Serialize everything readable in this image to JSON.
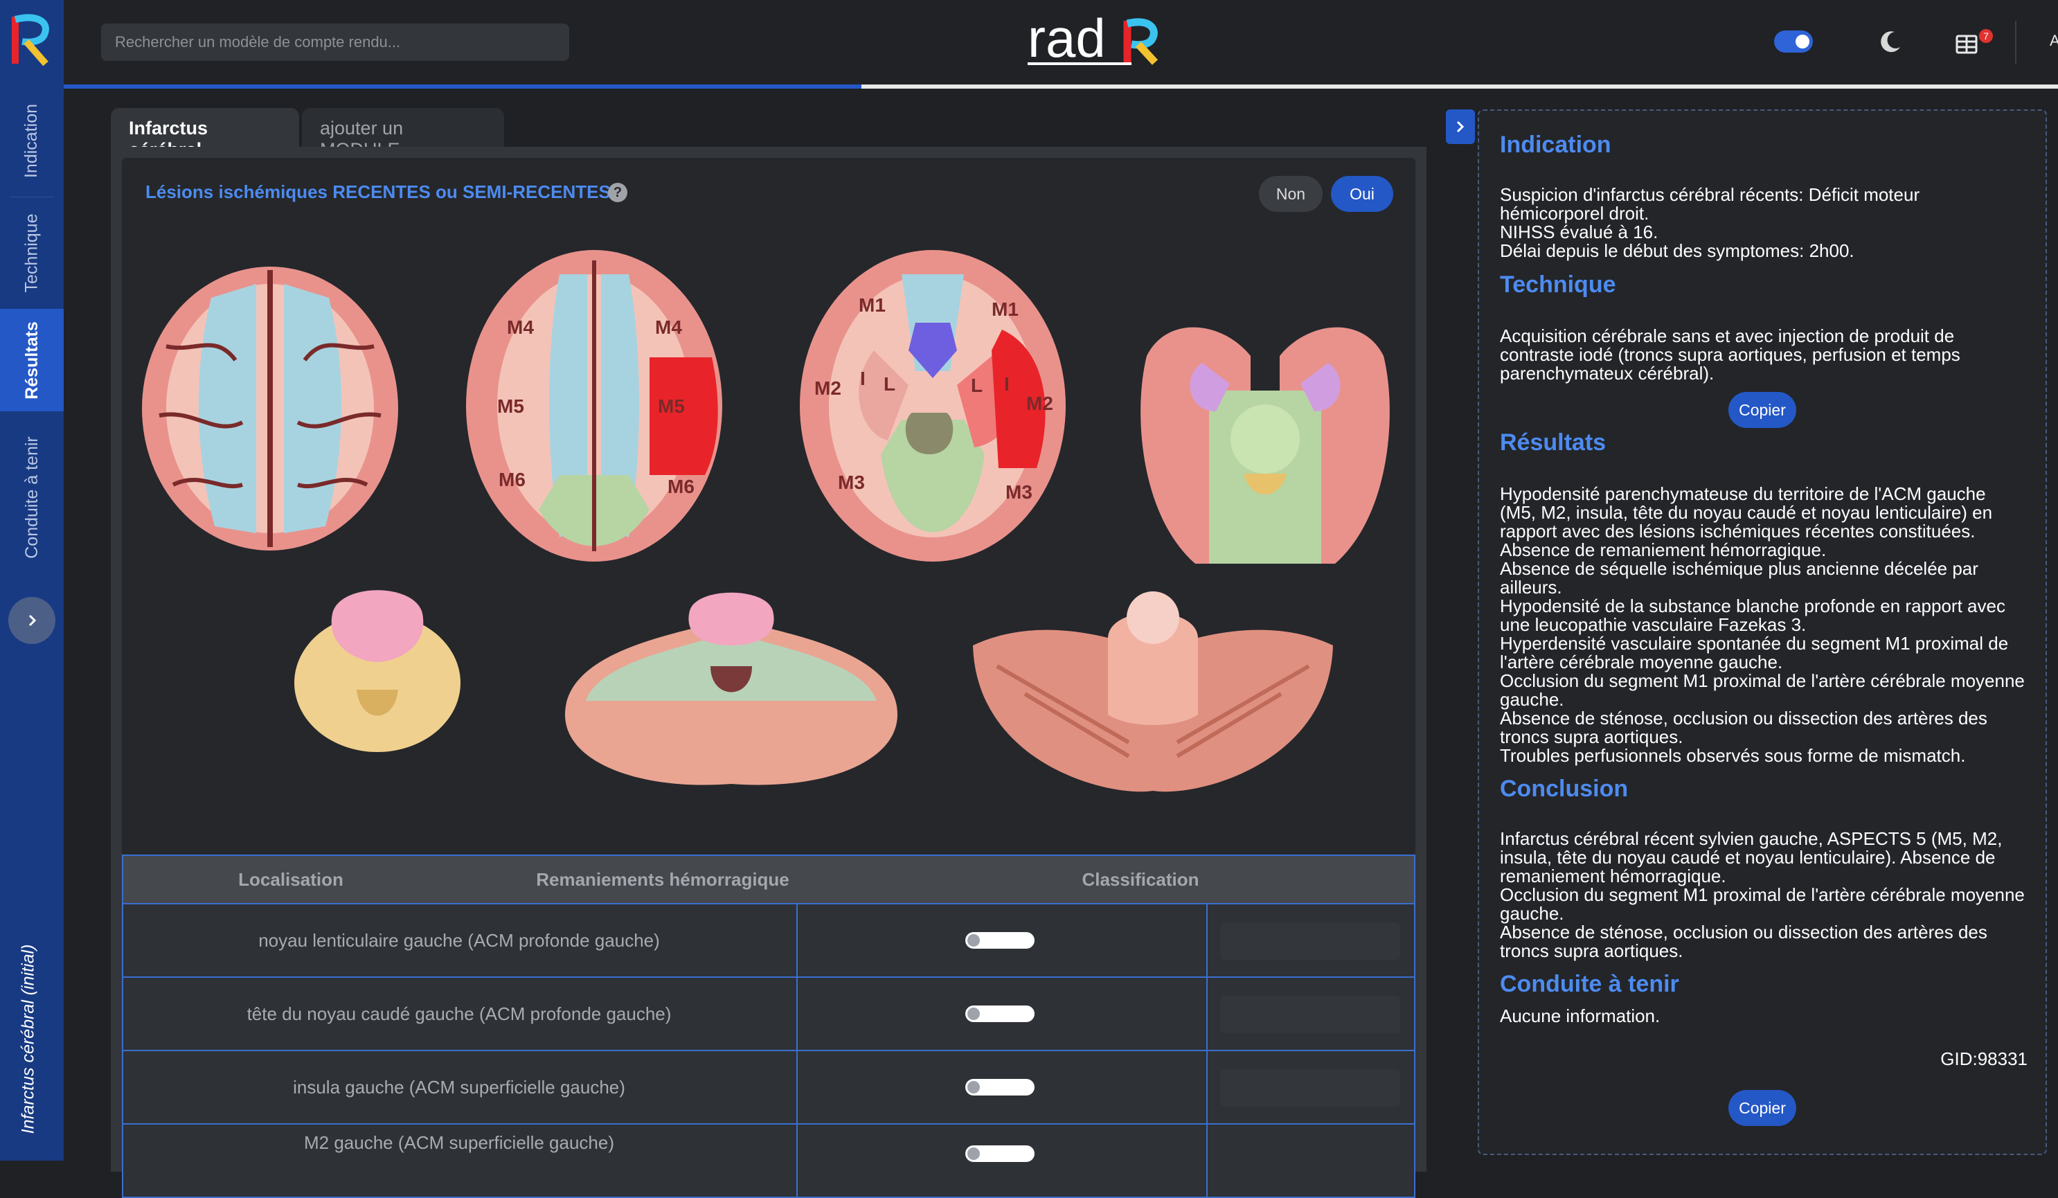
{
  "sidebar": {
    "tabs": [
      {
        "label": "Indication"
      },
      {
        "label": "Technique"
      },
      {
        "label": "Résultats"
      },
      {
        "label": "Conduite à tenir"
      }
    ],
    "footer": "Infarctus cérébral (initial)"
  },
  "topbar": {
    "search_placeholder": "Rechercher un modèle de compte rendu...",
    "brand": "radR",
    "notification_count": "7",
    "user_initial": "A",
    "progress": 0.4
  },
  "module_tabs": {
    "active": "Infarctus cérébral",
    "add": "ajouter un MODULE"
  },
  "question": {
    "title": "Lésions ischémiques RECENTES ou SEMI-RECENTES",
    "options": [
      "Non",
      "Oui"
    ],
    "selected": "Oui"
  },
  "brain_labels": {
    "m4": "M4",
    "m5": "M5",
    "m6": "M6",
    "m1": "M1",
    "m2": "M2",
    "m3": "M3",
    "l": "L",
    "i": "I"
  },
  "table": {
    "headers": [
      "Localisation",
      "Remaniements hémorragique",
      "Classification"
    ],
    "rows": [
      {
        "localisation": "noyau lenticulaire gauche (ACM profonde gauche)"
      },
      {
        "localisation": "tête du noyau caudé gauche (ACM profonde gauche)"
      },
      {
        "localisation": "insula gauche (ACM superficielle gauche)"
      },
      {
        "localisation": "M2 gauche (ACM superficielle gauche)"
      }
    ]
  },
  "report": {
    "indication_title": "Indication",
    "indication_text": "Suspicion d'infarctus cérébral récents: Déficit moteur hémicorporel droit.\nNIHSS évalué à 16.\nDélai depuis le début des symptomes: 2h00.",
    "technique_title": "Technique",
    "technique_text": "Acquisition cérébrale sans et avec injection de produit de contraste iodé (troncs supra aortiques, perfusion et temps parenchymateux cérébral).",
    "copy_label": "Copier",
    "resultats_title": "Résultats",
    "resultats_text": "Hypodensité parenchymateuse du territoire de l'ACM gauche (M5, M2, insula, tête du noyau caudé et noyau lenticulaire) en rapport avec des lésions ischémiques récentes constituées.\nAbsence de remaniement hémorragique.\nAbsence de séquelle ischémique plus ancienne décelée par ailleurs.\nHypodensité de la substance blanche profonde en rapport avec une leucopathie vasculaire Fazekas 3.\nHyperdensité vasculaire spontanée du segment M1 proximal de l'artère cérébrale moyenne gauche.\nOcclusion du segment M1 proximal de l'artère cérébrale moyenne gauche.\nAbsence de sténose, occlusion ou dissection des artères des troncs supra aortiques.\nTroubles perfusionnels observés sous forme de mismatch.",
    "conclusion_title": "Conclusion",
    "conclusion_text": "Infarctus cérébral récent sylvien gauche, ASPECTS 5 (M5, M2, insula, tête du noyau caudé et noyau lenticulaire). Absence de remaniement hémorragique.\nOcclusion du segment M1 proximal de l'artère cérébrale moyenne gauche.\nAbsence de sténose, occlusion ou dissection des artères des troncs supra aortiques.",
    "conduite_title": "Conduite à tenir",
    "conduite_text": "Aucune information.",
    "gid": "GID:98331"
  },
  "colors": {
    "accent": "#2458c6",
    "heading_blue": "#4d8bf0",
    "sidebar_bg": "#173a83",
    "lesion_red": "#e8242a"
  }
}
